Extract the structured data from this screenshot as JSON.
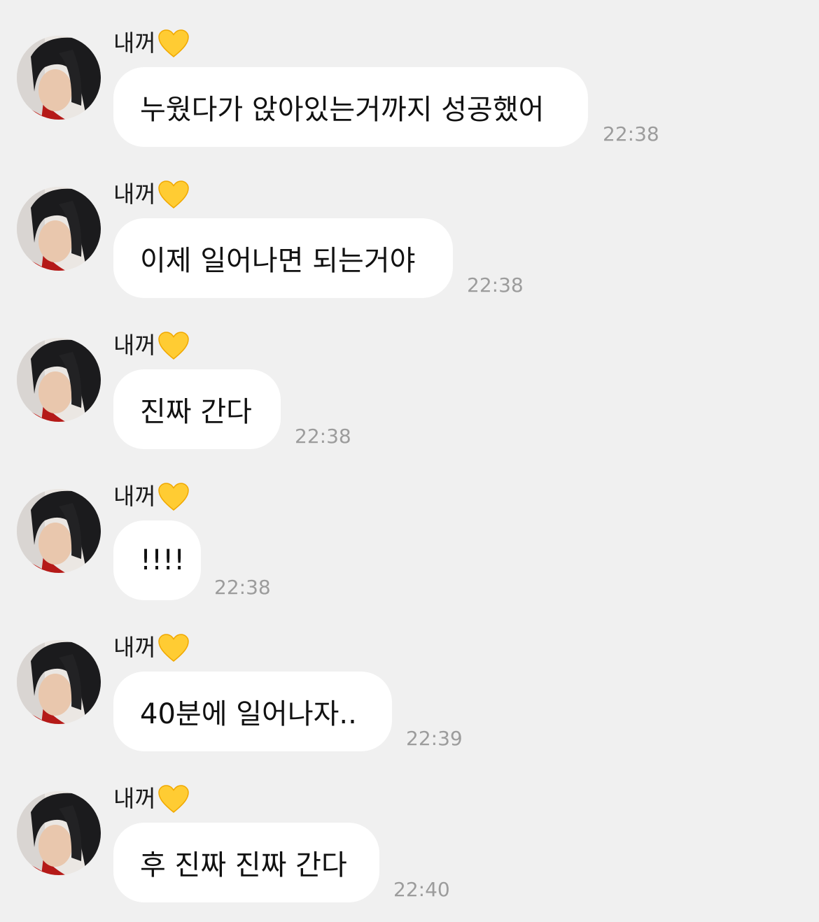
{
  "messages": [
    {
      "sender": "내꺼",
      "sender_emoji": "yellow-heart-icon",
      "text": "누웠다가 앉아있는거까지 성공했어",
      "time": "22:38"
    },
    {
      "sender": "내꺼",
      "sender_emoji": "yellow-heart-icon",
      "text": "이제 일어나면 되는거야",
      "time": "22:38"
    },
    {
      "sender": "내꺼",
      "sender_emoji": "yellow-heart-icon",
      "text": "진짜 간다",
      "time": "22:38"
    },
    {
      "sender": "내꺼",
      "sender_emoji": "yellow-heart-icon",
      "text": "!!!!",
      "time": "22:38"
    },
    {
      "sender": "내꺼",
      "sender_emoji": "yellow-heart-icon",
      "text": "40분에 일어나자..",
      "time": "22:39"
    },
    {
      "sender": "내꺼",
      "sender_emoji": "yellow-heart-icon",
      "text": "후 진짜 진짜 간다",
      "time": "22:40"
    }
  ],
  "colors": {
    "background": "#f0f0f0",
    "bubble": "#ffffff",
    "text": "#111111",
    "timestamp": "#9c9c9c",
    "heart": "#ffcc33"
  }
}
